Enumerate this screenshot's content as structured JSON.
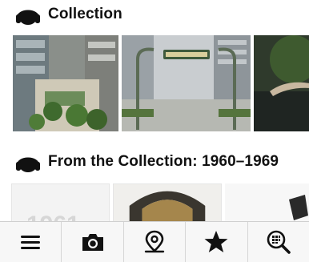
{
  "sections": [
    {
      "title": "Collection",
      "icon": "headphones-icon"
    },
    {
      "title": "From the Collection: 1960–1969",
      "icon": "headphones-icon"
    }
  ],
  "partial_thumb_text": "1961",
  "tabbar": {
    "items": [
      {
        "icon": "menu-icon"
      },
      {
        "icon": "camera-icon"
      },
      {
        "icon": "location-pin-icon"
      },
      {
        "icon": "star-icon"
      },
      {
        "icon": "zoom-grid-icon"
      }
    ]
  }
}
